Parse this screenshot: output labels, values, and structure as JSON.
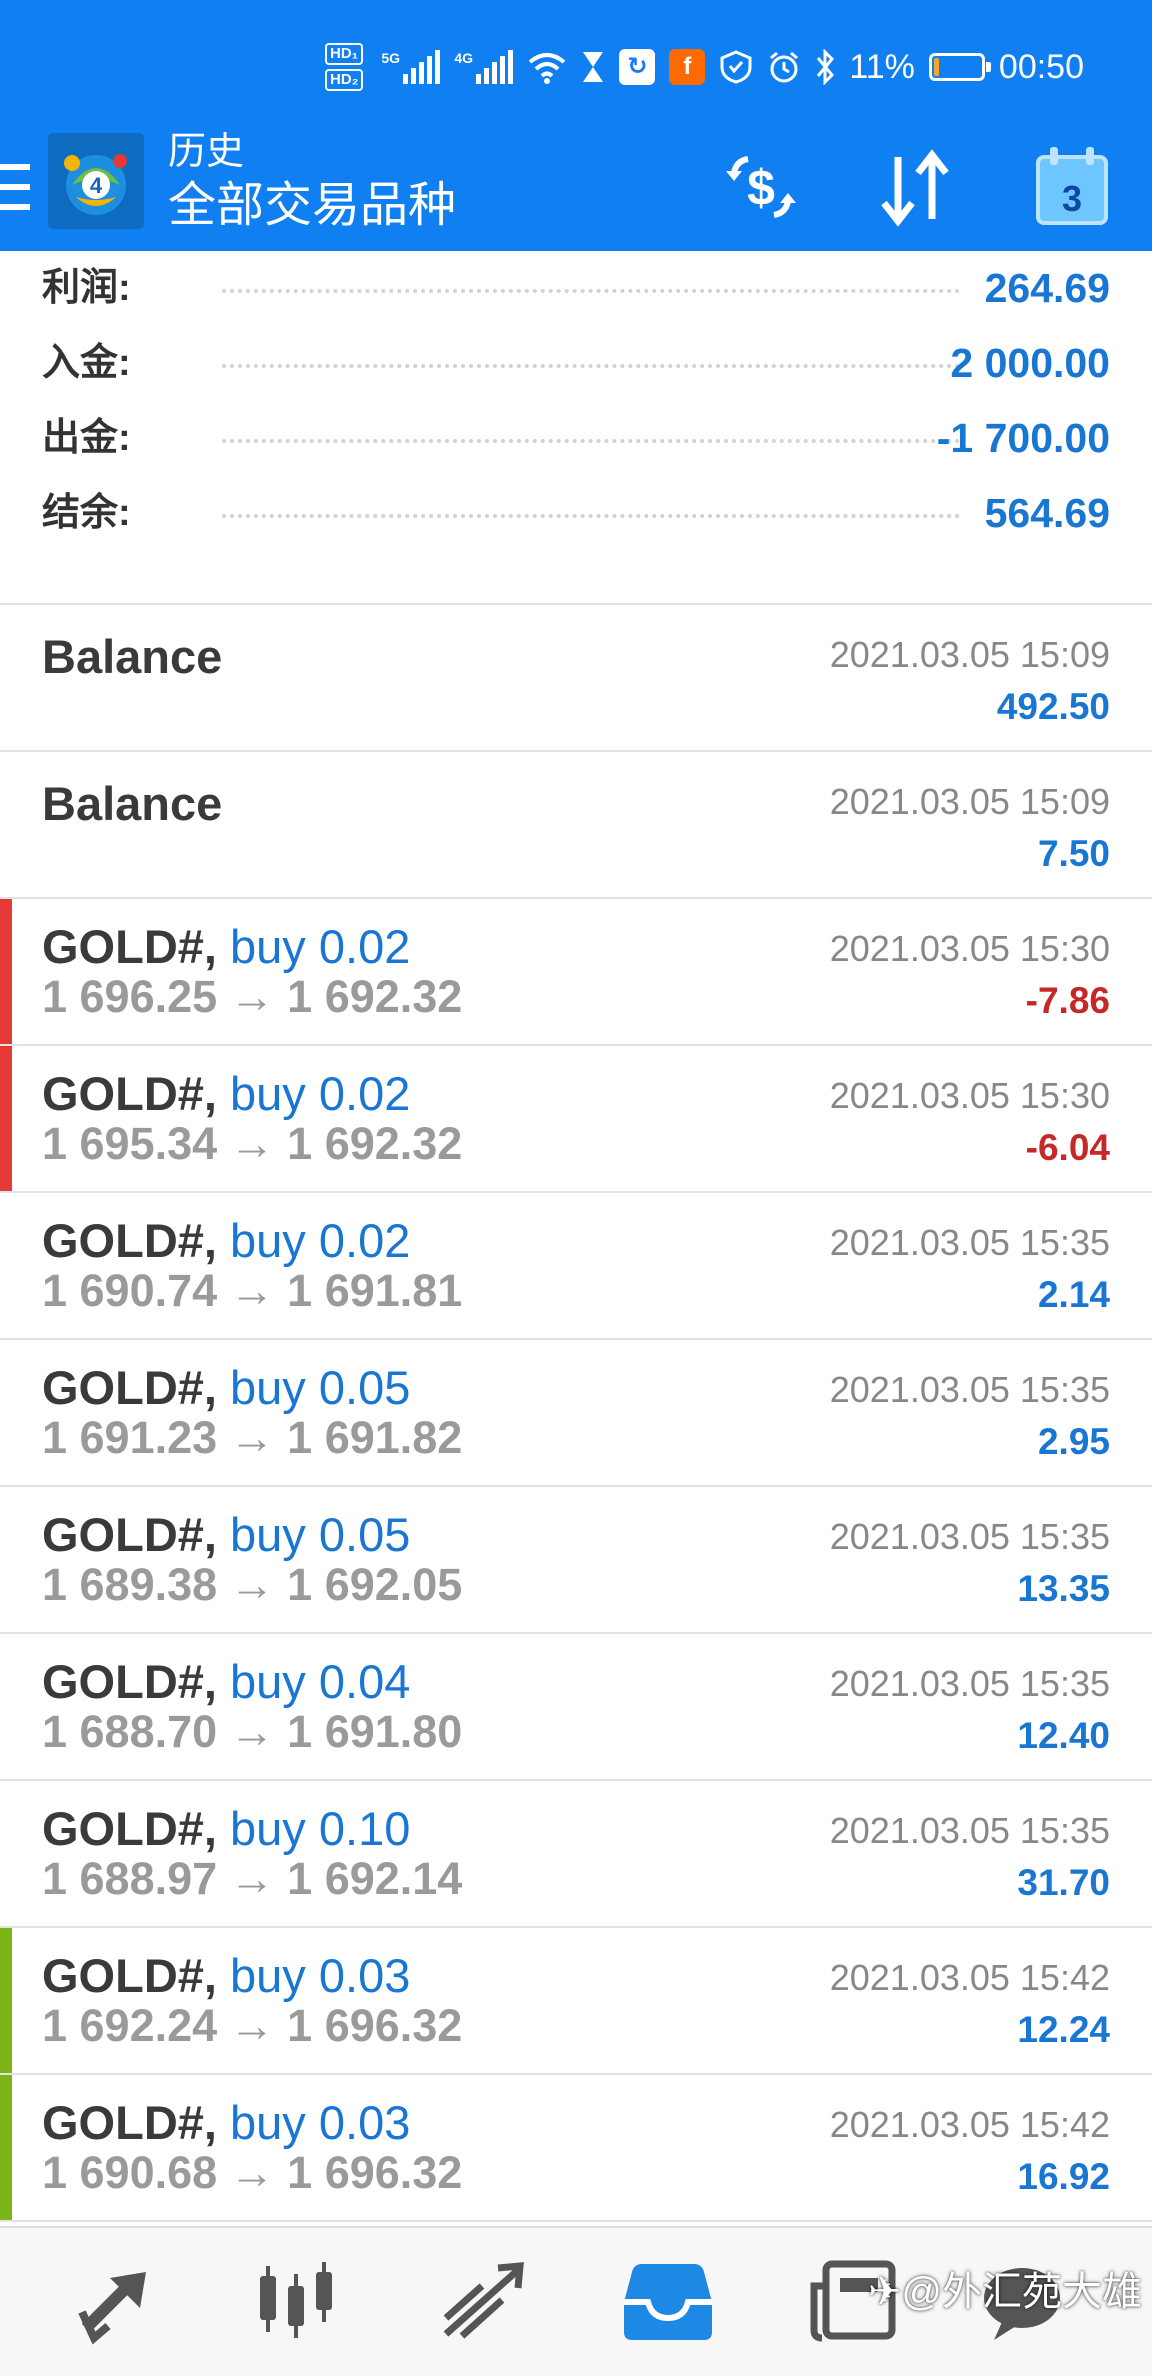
{
  "status_bar": {
    "hd1": "HD₁",
    "hd2": "HD₂",
    "net1": "5G",
    "net2": "4G",
    "battery_percent": "11%",
    "battery_level": 0.11,
    "time": "00:50",
    "icons": [
      "signal-icon",
      "wifi-icon",
      "hourglass-icon",
      "refresh-app-icon",
      "flash-app-icon",
      "shield-app-icon",
      "alarm-icon",
      "bluetooth-icon",
      "battery-icon"
    ]
  },
  "toolbar": {
    "title": "历史",
    "subtitle": "全部交易品种",
    "calendar_day": "3",
    "color": "#0f7ff2"
  },
  "summary": [
    {
      "label": "利润:",
      "value": "264.69"
    },
    {
      "label": "入金:",
      "value": "2 000.00"
    },
    {
      "label": "出金:",
      "value": "-1 700.00"
    },
    {
      "label": "结余:",
      "value": "564.69"
    }
  ],
  "history": [
    {
      "type": "balance",
      "title": "Balance",
      "time": "2021.03.05 15:09",
      "profit": "492.50",
      "profit_color": "#1976d2",
      "marker_color": ""
    },
    {
      "type": "balance",
      "title": "Balance",
      "time": "2021.03.05 15:09",
      "profit": "7.50",
      "profit_color": "#1976d2",
      "marker_color": ""
    },
    {
      "type": "deal",
      "symbol": "GOLD#,",
      "deal": "buy 0.02",
      "prices": "1 696.25 → 1 692.32",
      "time": "2021.03.05 15:30",
      "profit": "-7.86",
      "profit_color": "#c62828",
      "marker_color": "#e53935"
    },
    {
      "type": "deal",
      "symbol": "GOLD#,",
      "deal": "buy 0.02",
      "prices": "1 695.34 → 1 692.32",
      "time": "2021.03.05 15:30",
      "profit": "-6.04",
      "profit_color": "#c62828",
      "marker_color": "#e53935"
    },
    {
      "type": "deal",
      "symbol": "GOLD#,",
      "deal": "buy 0.02",
      "prices": "1 690.74 → 1 691.81",
      "time": "2021.03.05 15:35",
      "profit": "2.14",
      "profit_color": "#1976d2",
      "marker_color": ""
    },
    {
      "type": "deal",
      "symbol": "GOLD#,",
      "deal": "buy 0.05",
      "prices": "1 691.23 → 1 691.82",
      "time": "2021.03.05 15:35",
      "profit": "2.95",
      "profit_color": "#1976d2",
      "marker_color": ""
    },
    {
      "type": "deal",
      "symbol": "GOLD#,",
      "deal": "buy 0.05",
      "prices": "1 689.38 → 1 692.05",
      "time": "2021.03.05 15:35",
      "profit": "13.35",
      "profit_color": "#1976d2",
      "marker_color": ""
    },
    {
      "type": "deal",
      "symbol": "GOLD#,",
      "deal": "buy 0.04",
      "prices": "1 688.70 → 1 691.80",
      "time": "2021.03.05 15:35",
      "profit": "12.40",
      "profit_color": "#1976d2",
      "marker_color": ""
    },
    {
      "type": "deal",
      "symbol": "GOLD#,",
      "deal": "buy 0.10",
      "prices": "1 688.97 → 1 692.14",
      "time": "2021.03.05 15:35",
      "profit": "31.70",
      "profit_color": "#1976d2",
      "marker_color": ""
    },
    {
      "type": "deal",
      "symbol": "GOLD#,",
      "deal": "buy 0.03",
      "prices": "1 692.24 → 1 696.32",
      "time": "2021.03.05 15:42",
      "profit": "12.24",
      "profit_color": "#1976d2",
      "marker_color": "#7cb518"
    },
    {
      "type": "deal",
      "symbol": "GOLD#,",
      "deal": "buy 0.03",
      "prices": "1 690.68 → 1 696.32",
      "time": "2021.03.05 15:42",
      "profit": "16.92",
      "profit_color": "#1976d2",
      "marker_color": "#7cb518"
    }
  ],
  "bottom_nav": {
    "items": [
      "quotes-icon",
      "chart-candles-icon",
      "trade-icon",
      "history-inbox-icon",
      "news-icon",
      "chat-icon"
    ],
    "active": "history-inbox-icon",
    "active_color": "#1e88e5"
  },
  "watermark": "✈@外汇苑大雄"
}
